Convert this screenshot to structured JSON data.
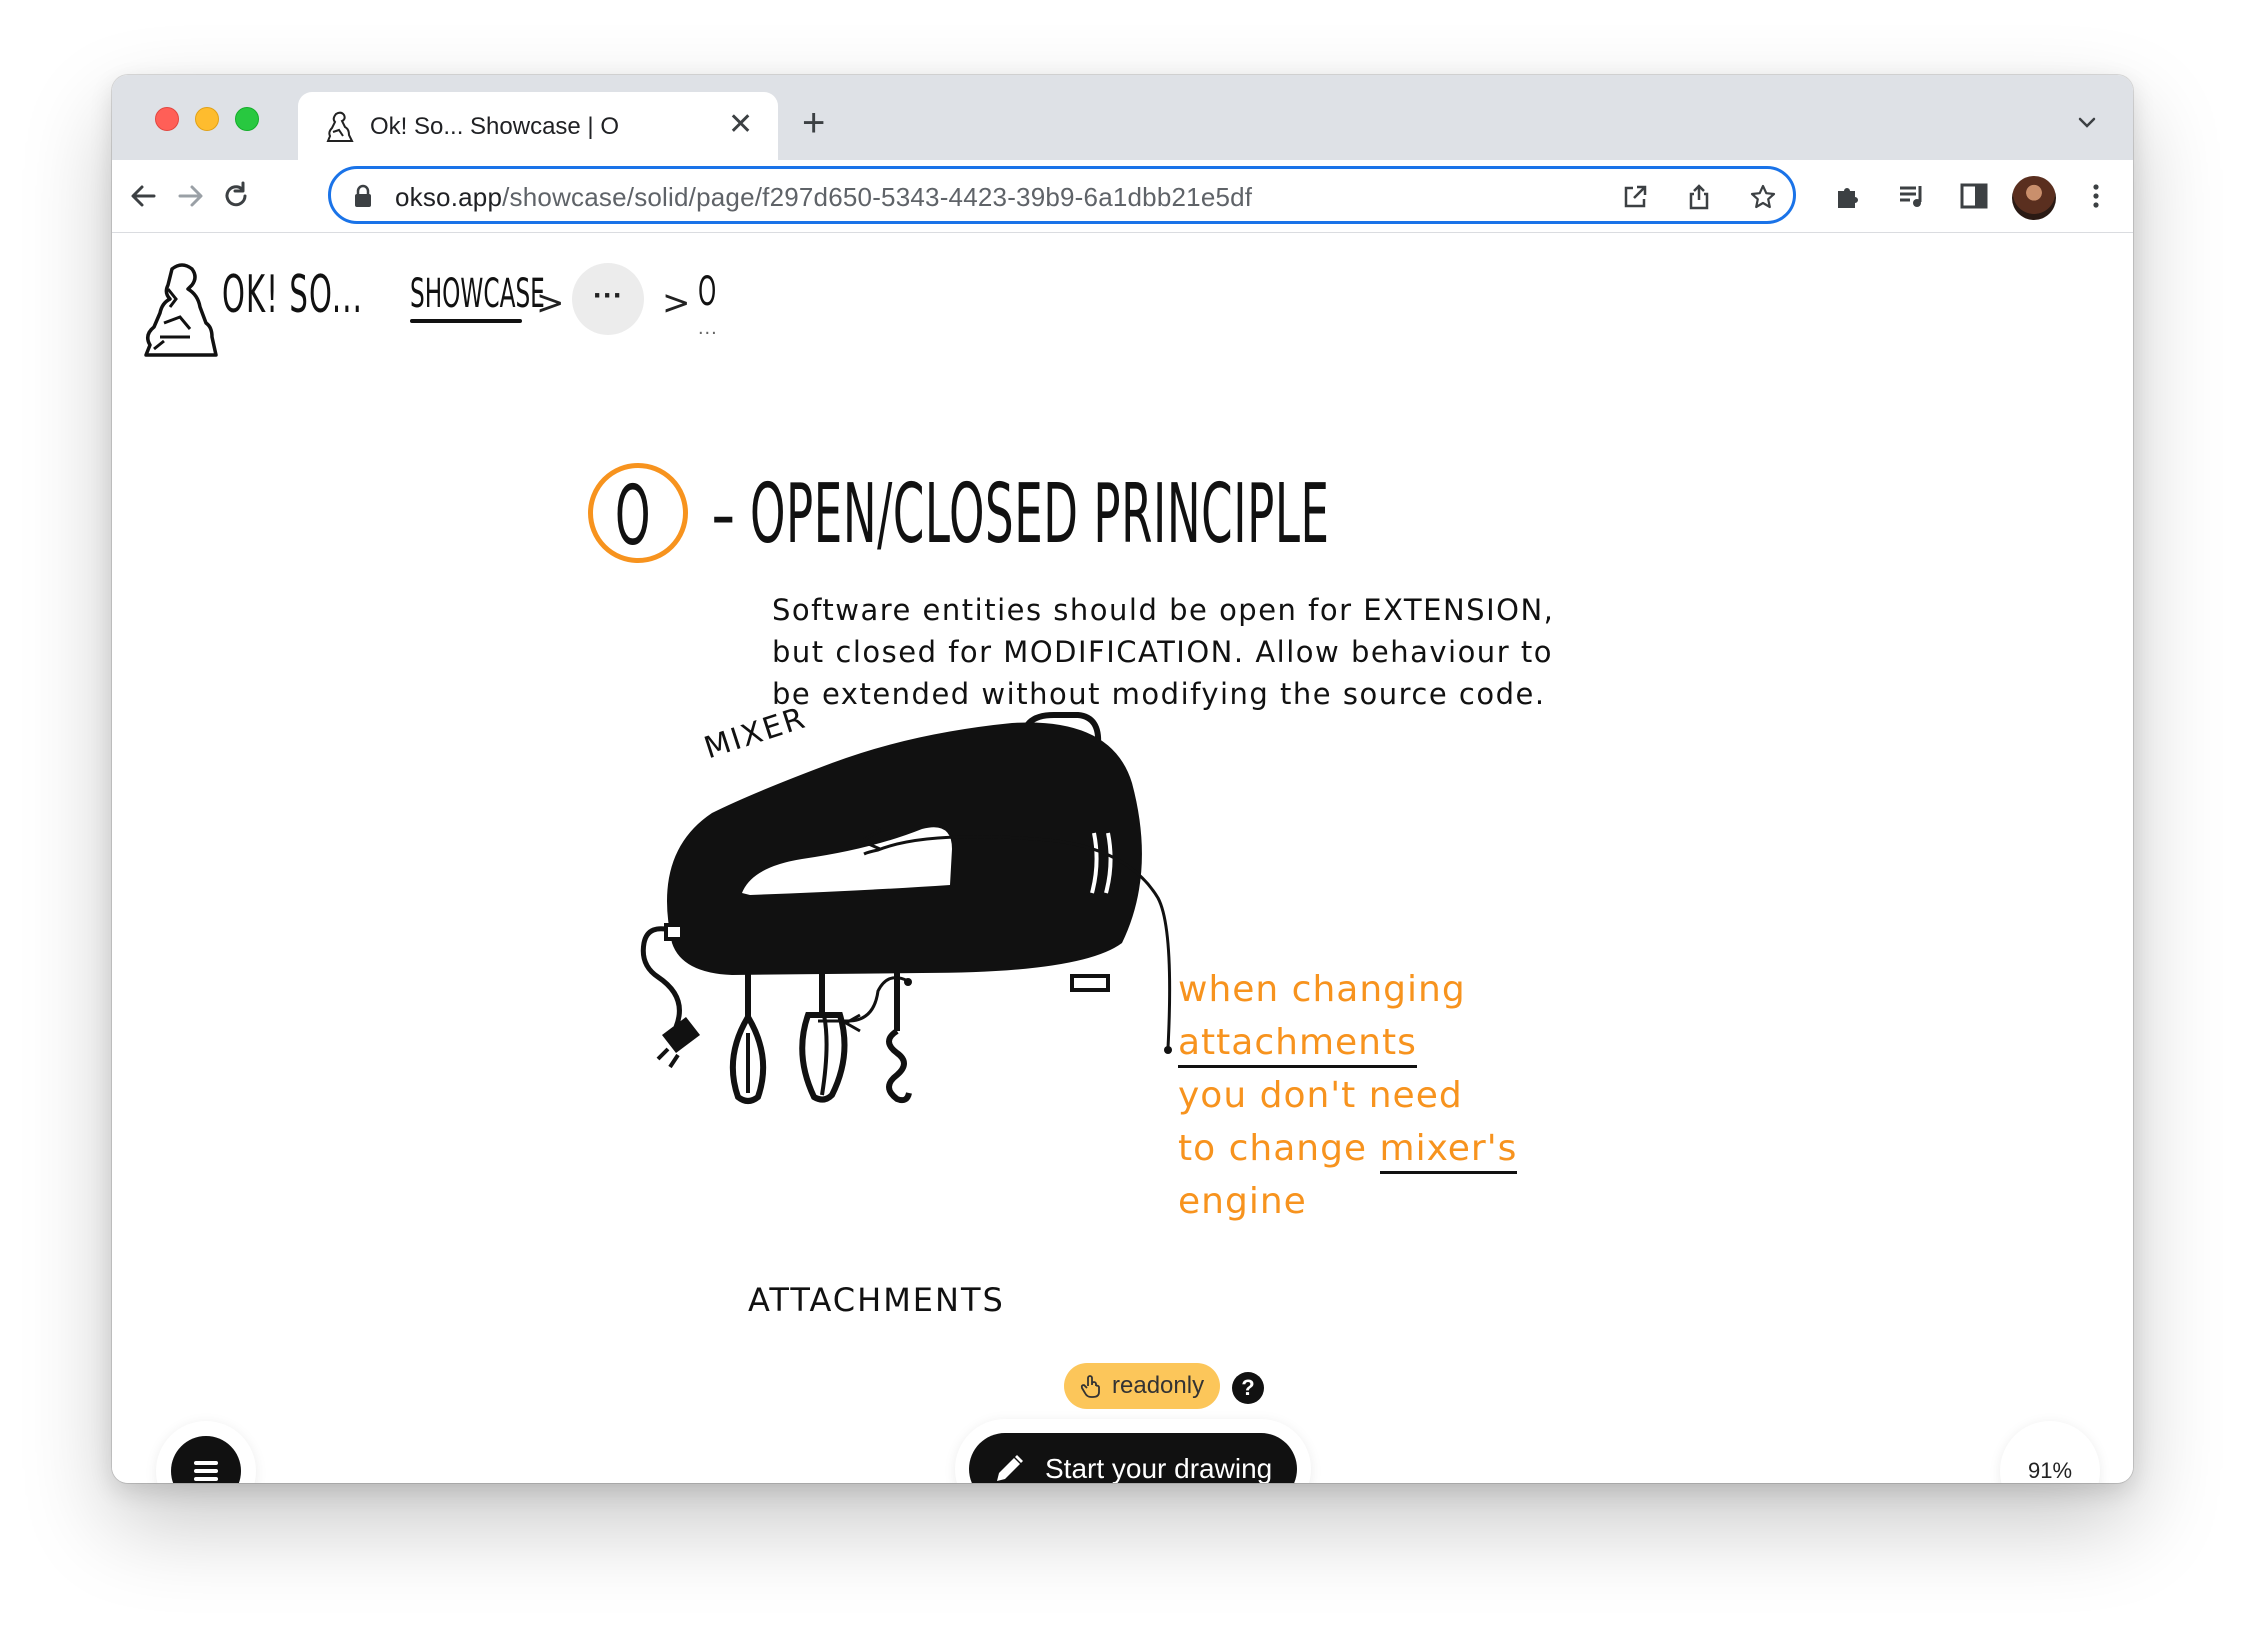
{
  "browser": {
    "tab_title": "Ok! So... Showcase | O",
    "tab_close": "✕",
    "new_tab": "+",
    "url_host": "okso.app",
    "url_path": "/showcase/solid/page/f297d650-5343-4423-39b9-6a1dbb21e5df"
  },
  "header": {
    "brand": "OK! SO...",
    "breadcrumb": {
      "showcase": "SHOWCASE",
      "separator": ">",
      "more": "···",
      "current": "O",
      "current_dots": "..."
    }
  },
  "page": {
    "title_letter": "O",
    "title_text": "– OPEN/CLOSED PRINCIPLE",
    "accent_color": "#f7931e",
    "description": "Software entities should be open for EXTENSION, but closed for MODIFICATION. Allow behaviour to be extended without modifying the source code."
  },
  "drawing": {
    "mixer_label": "MIXER",
    "attachments_label": "ATTACHMENTS",
    "note_lines": {
      "line1": "when changing",
      "line2": "attachments",
      "line3": "you don't need",
      "line4_a": "to change ",
      "line4_b": "mixer's",
      "line5": "engine"
    }
  },
  "controls": {
    "readonly_label": "readonly",
    "readonly_color": "#fcc65a",
    "help": "?",
    "start_drawing": "Start your drawing",
    "zoom": "91%"
  }
}
